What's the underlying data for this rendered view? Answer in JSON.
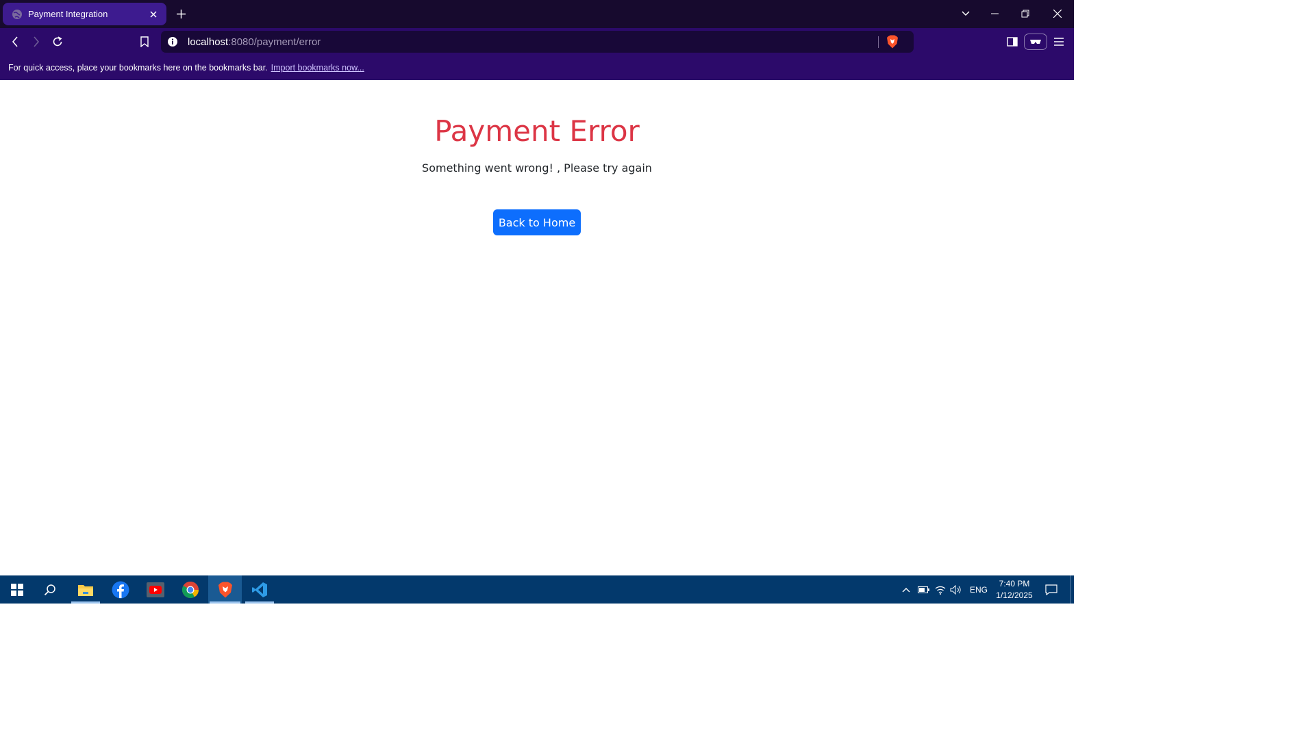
{
  "browser": {
    "tab": {
      "title": "Payment Integration"
    },
    "address": {
      "host": "localhost",
      "rest": ":8080/payment/error"
    },
    "bookmarks_bar": {
      "message": "For quick access, place your bookmarks here on the bookmarks bar.",
      "link": "Import bookmarks now..."
    },
    "icons": [
      "globe-icon",
      "close-icon",
      "plus-icon",
      "chevron-down-icon",
      "minimize-icon",
      "restore-icon",
      "back-icon",
      "forward-icon",
      "reload-icon",
      "bookmark-icon",
      "info-icon",
      "brave-shield-icon",
      "sidebar-icon",
      "rewards-icon",
      "menu-icon"
    ]
  },
  "page": {
    "title": "Payment Error",
    "message": "Something went wrong! , Please try again",
    "button": "Back to Home"
  },
  "colors": {
    "title_red": "#dc3545",
    "button_blue": "#0d6efd",
    "tab_active": "#3d1b8f",
    "toolbar": "#2c0a6a",
    "taskbar": "#03396c"
  },
  "taskbar": {
    "apps": [
      "windows-start-icon",
      "search-icon",
      "file-explorer-icon",
      "facebook-icon",
      "youtube-icon",
      "chrome-icon",
      "brave-icon",
      "vscode-icon"
    ],
    "language": "ENG",
    "time": "7:40 PM",
    "date": "1/12/2025"
  }
}
